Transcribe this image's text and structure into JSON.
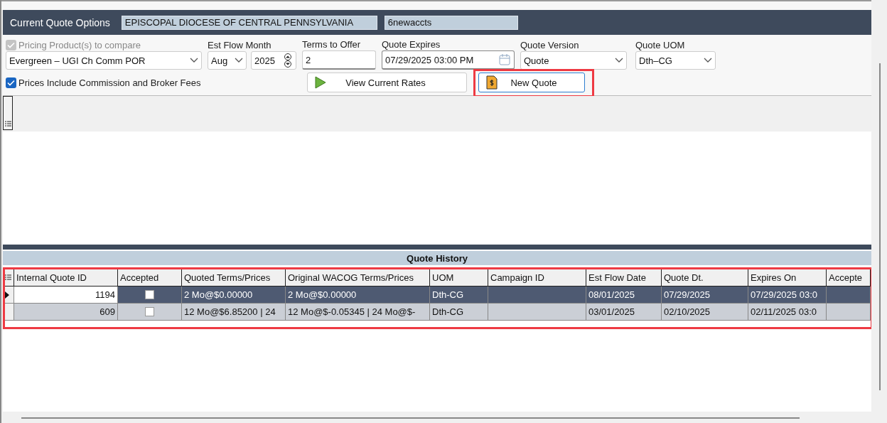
{
  "header": {
    "title": "Current Quote Options",
    "customer": "EPISCOPAL DIOCESE OF CENTRAL PENNSYLVANIA",
    "account": "6newaccts"
  },
  "options": {
    "pricing": {
      "label": "Pricing Product(s) to compare",
      "checked": true,
      "disabled": true,
      "value": "Evergreen – UGI Ch Comm POR"
    },
    "flow_month": {
      "label": "Est Flow Month",
      "month": "Aug",
      "year": "2025"
    },
    "terms": {
      "label": "Terms to Offer",
      "value": "2"
    },
    "expires": {
      "label": "Quote Expires",
      "value": "07/29/2025 03:00 PM"
    },
    "version": {
      "label": "Quote Version",
      "value": "Quote"
    },
    "uom": {
      "label": "Quote UOM",
      "value": "Dth–CG"
    },
    "commission": {
      "label": "Prices Include Commission and Broker Fees",
      "checked": true
    },
    "buttons": [
      {
        "kind": "play",
        "label": "View Current Rates",
        "highlighted": false
      },
      {
        "kind": "quote",
        "label": "New Quote",
        "highlighted": true
      }
    ]
  },
  "history": {
    "title": "Quote History",
    "highlighted": true,
    "columns": [
      "Internal Quote ID",
      "Accepted",
      "Quoted Terms/Prices",
      "Original WACOG Terms/Prices",
      "UOM",
      "Campaign ID",
      "Est Flow Date",
      "Quote Dt.",
      "Expires On",
      "Accepte"
    ],
    "rows": [
      {
        "selected": true,
        "accepted": false,
        "cells": [
          "1194",
          "",
          "2 Mo@$0.00000",
          "2 Mo@$0.00000",
          "Dth-CG",
          "",
          "08/01/2025",
          "07/29/2025",
          "07/29/2025 03:0",
          ""
        ]
      },
      {
        "selected": false,
        "accepted": false,
        "cells": [
          "609",
          "",
          "12 Mo@$6.85200 | 24",
          "12 Mo@$-0.05345 | 24 Mo@$-",
          "Dth-CG",
          "",
          "03/01/2025",
          "02/10/2025",
          "02/11/2025 03:0",
          ""
        ]
      }
    ]
  }
}
